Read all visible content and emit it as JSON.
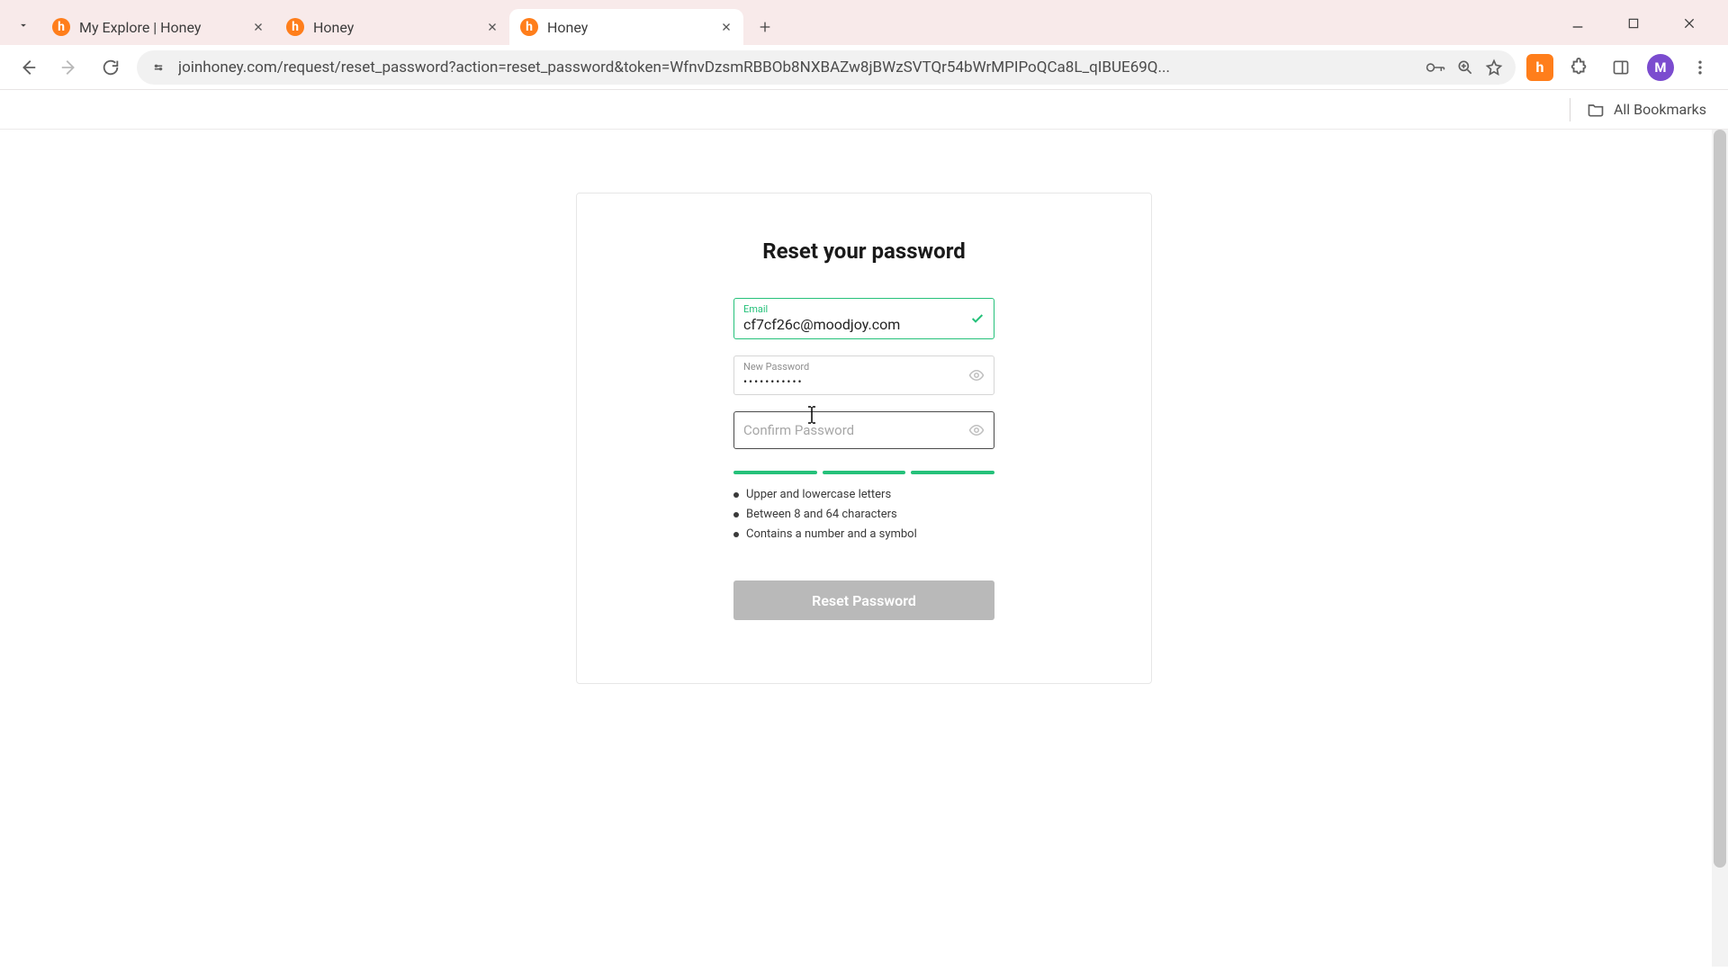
{
  "browser": {
    "tabs": [
      {
        "title": "My Explore | Honey",
        "active": false
      },
      {
        "title": "Honey",
        "active": false
      },
      {
        "title": "Honey",
        "active": true
      }
    ],
    "url": "joinhoney.com/request/reset_password?action=reset_password&token=WfnvDzsmRBBOb8NXBAZw8jBWzSVTQr54bWrMPIPoQCa8L_qIBUE69Q...",
    "bookmarks_label": "All Bookmarks",
    "avatar_initial": "M",
    "extension_initial": "h",
    "favicon_initial": "h"
  },
  "form": {
    "title": "Reset your password",
    "email": {
      "label": "Email",
      "value": "cf7cf26c@moodjoy.com"
    },
    "new_password": {
      "label": "New Password",
      "masked_value": "●●●●●●●●●●●"
    },
    "confirm_password": {
      "placeholder": "Confirm Password"
    },
    "requirements": {
      "r0": "Upper and lowercase letters",
      "r1": "Between 8 and 64 characters",
      "r2": "Contains a number and a symbol"
    },
    "submit_label": "Reset Password"
  }
}
